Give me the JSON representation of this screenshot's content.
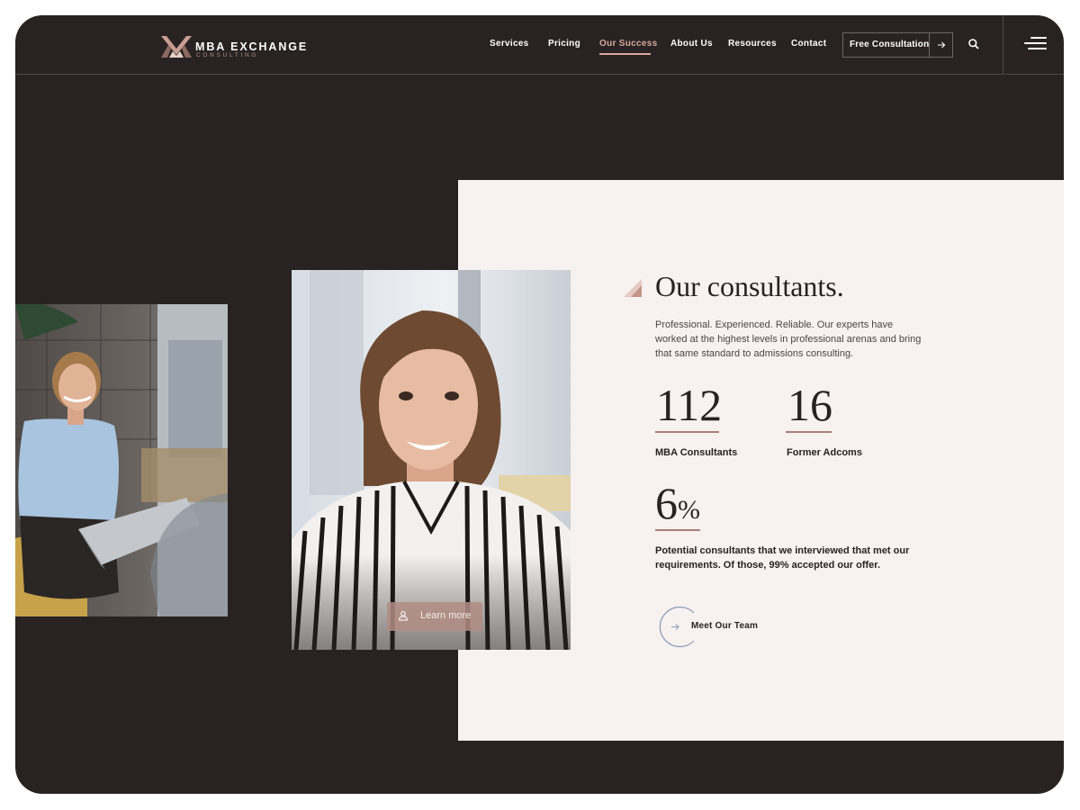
{
  "brand": {
    "name": "MBA EXCHANGE",
    "sub": "CONSULTING"
  },
  "nav": {
    "items": [
      {
        "label": "Services"
      },
      {
        "label": "Pricing"
      },
      {
        "label": "Our Success",
        "active": true
      },
      {
        "label": "About Us"
      },
      {
        "label": "Resources"
      },
      {
        "label": "Contact"
      }
    ],
    "cta_label": "Free Consultation"
  },
  "icons": {
    "logo": "logo-mark-icon",
    "cta": "arrow-right-icon",
    "search": "search-icon",
    "menu": "hamburger-menu-icon",
    "learn_more": "user-icon",
    "team": "arrow-right-icon",
    "title_accent": "triangle-accent-icon"
  },
  "photos": {
    "learn_more_label": "Learn more"
  },
  "content": {
    "title": "Our consultants.",
    "description": "Professional. Experienced. Reliable. Our experts have worked at the highest levels in professional arenas and bring that same standard to admissions consulting.",
    "stats": [
      {
        "number": "112",
        "label": "MBA Consultants"
      },
      {
        "number": "16",
        "label": "Former Adcoms"
      },
      {
        "number": "6",
        "suffix": "%",
        "label": "Potential consultants that we interviewed that met our requirements. Of those, 99% accepted our offer."
      }
    ],
    "team_button_label": "Meet Our Team"
  },
  "colors": {
    "dark_background": "#282322",
    "light_panel": "#f7f1f0",
    "accent_rose": "#d5a99d",
    "stat_underline": "#a97f75",
    "team_circle": "#8a9ab8"
  }
}
